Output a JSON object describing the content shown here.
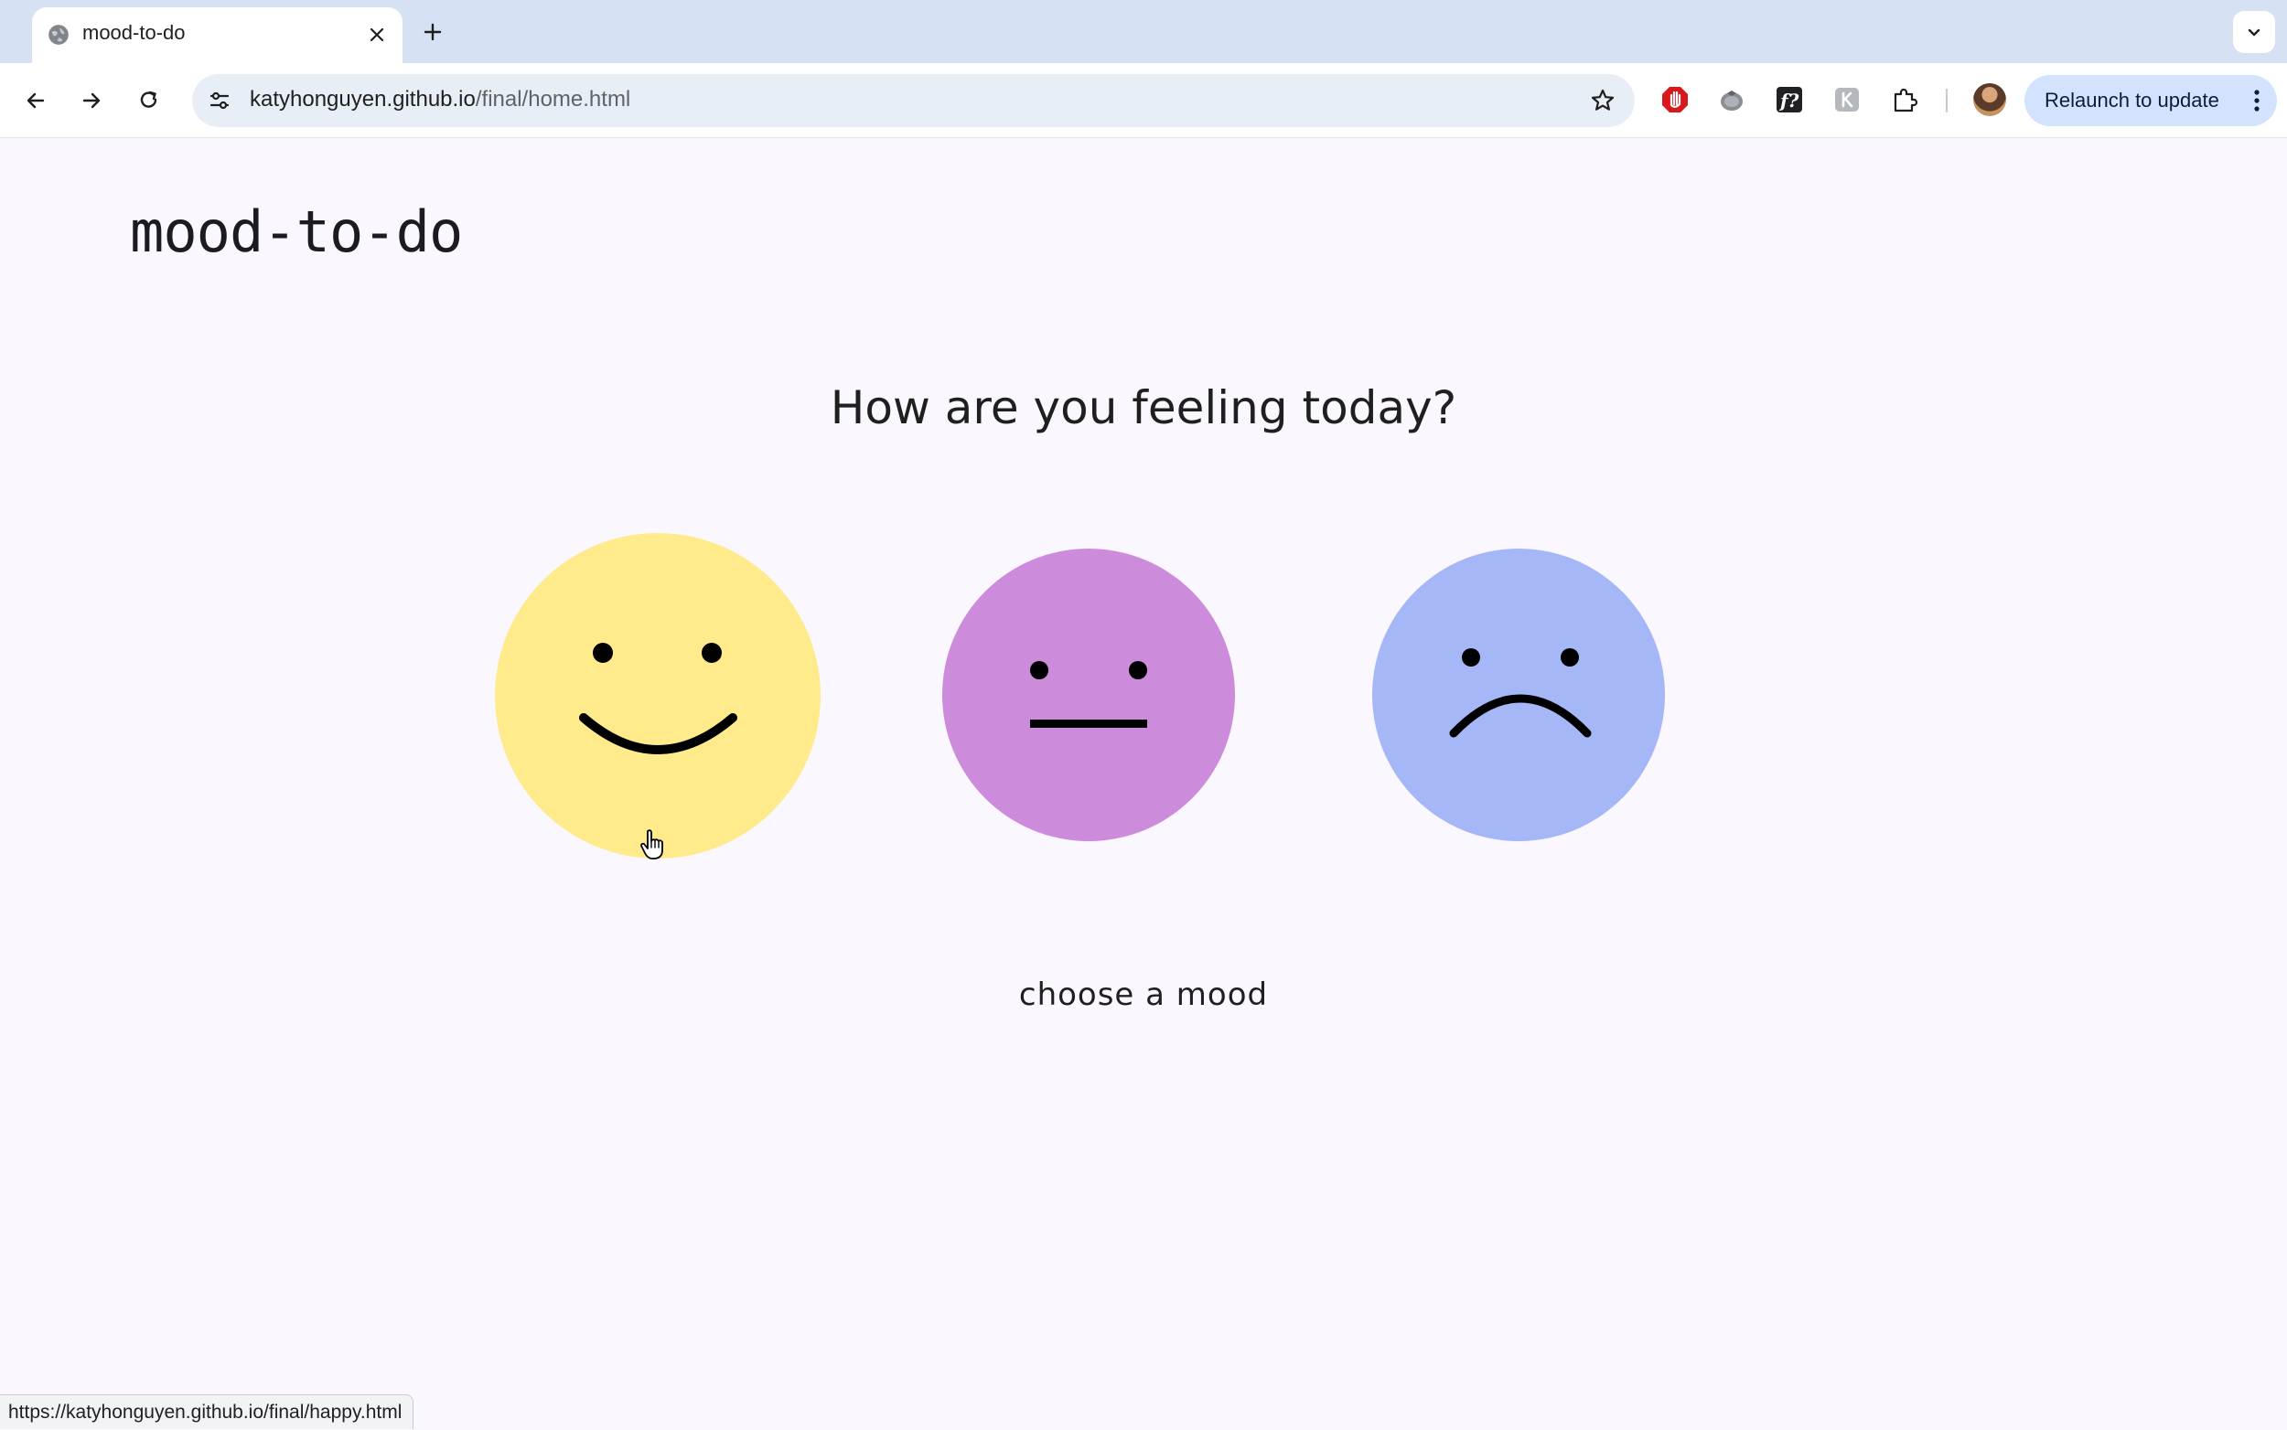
{
  "browser": {
    "tab": {
      "title": "mood-to-do"
    },
    "address_bar": {
      "host": "katyhonguyen.github.io",
      "path": "/final/home.html"
    },
    "relaunch_label": "Relaunch to update",
    "status_url": "https://katyhonguyen.github.io/final/happy.html"
  },
  "page": {
    "brand": "mood-to-do",
    "prompt": "How are you feeling today?",
    "moods": [
      {
        "mood": "happy",
        "color": "#ffeb8c"
      },
      {
        "mood": "neutral",
        "color": "#cc8bdb"
      },
      {
        "mood": "sad",
        "color": "#a6b7f8"
      }
    ],
    "footer": "choose a mood"
  },
  "colors": {
    "page_background": "#faf7fe",
    "tabstrip": "#d6e2f3",
    "omnibox": "#e8eef6",
    "relaunch_button": "#d3e3fd"
  }
}
